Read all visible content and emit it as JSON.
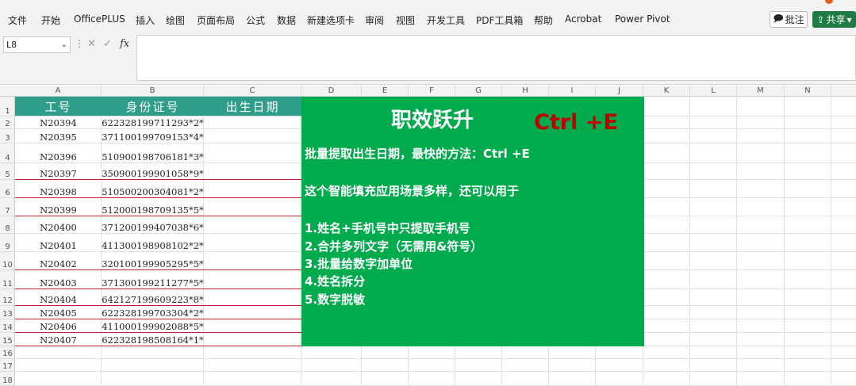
{
  "ribbon": {
    "tabs": [
      "文件",
      "开始",
      "OfficePLUS",
      "插入",
      "绘图",
      "页面布局",
      "公式",
      "数据",
      "新建选项卡",
      "审阅",
      "视图",
      "开发工具",
      "PDF工具箱",
      "帮助",
      "Acrobat",
      "Power Pivot"
    ],
    "comment_label": "批注",
    "share_label": "共享"
  },
  "formula_bar": {
    "name_box": "L8",
    "fx_label": "fx",
    "formula": ""
  },
  "sheet": {
    "columns": [
      "A",
      "B",
      "C",
      "D",
      "E",
      "F",
      "G",
      "H",
      "I",
      "J",
      "K",
      "L",
      "M",
      "N"
    ],
    "rows": [
      "1",
      "2",
      "3",
      "4",
      "5",
      "6",
      "7",
      "8",
      "9",
      "10",
      "11",
      "12",
      "13",
      "14",
      "15",
      "16",
      "17",
      "18"
    ],
    "headers": {
      "id": "工号",
      "id_card": "身份证号",
      "birth_date": "出生日期"
    },
    "records": [
      {
        "id": "N20394",
        "id_card": "622328199711293*2*"
      },
      {
        "id": "N20395",
        "id_card": "371100199709153*4*"
      },
      {
        "id": "N20396",
        "id_card": "510900198706181*3*"
      },
      {
        "id": "N20397",
        "id_card": "350900199901058*9*"
      },
      {
        "id": "N20398",
        "id_card": "510500200304081*2*"
      },
      {
        "id": "N20399",
        "id_card": "512000198709135*5*"
      },
      {
        "id": "N20400",
        "id_card": "371200199407038*6*"
      },
      {
        "id": "N20401",
        "id_card": "411300198908102*2*"
      },
      {
        "id": "N20402",
        "id_card": "320100199905295*5*"
      },
      {
        "id": "N20403",
        "id_card": "371300199211277*5*"
      },
      {
        "id": "N20404",
        "id_card": "642127199609223*8*"
      },
      {
        "id": "N20405",
        "id_card": "622328199703304*2*"
      },
      {
        "id": "N20406",
        "id_card": "411000199902088*5*"
      },
      {
        "id": "N20407",
        "id_card": "622328198508164*1*"
      }
    ]
  },
  "panel": {
    "title": "职效跃升",
    "shortcut": "Ctrl +E",
    "lines": [
      "批量提取出生日期，最快的方法：Ctrl +E",
      "这个智能填充应用场景多样，还可以用于",
      "1.姓名+手机号中只提取手机号",
      "2.合并多列文字（无需用&符号）",
      "3.批量给数字加单位",
      "4.姓名拆分",
      "5.数字脱敏"
    ]
  },
  "colors": {
    "header_teal": "#2e9e8a",
    "panel_green": "#00ab4e",
    "shortcut_red": "#c00000",
    "row_border_red": "#c0202a",
    "share_green": "#1f7a45"
  }
}
